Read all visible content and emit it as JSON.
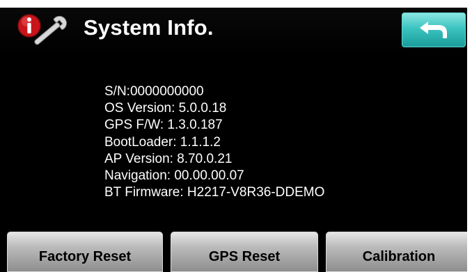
{
  "header": {
    "title": "System Info.",
    "icon": "info-wrench-icon",
    "back_icon": "back-arrow-icon",
    "back_color": "#3cc3c0"
  },
  "info": {
    "lines": [
      "S/N:0000000000",
      "OS Version: 5.0.0.18",
      "GPS F/W: 1.3.0.187",
      "BootLoader: 1.1.1.2",
      "AP Version: 8.70.0.21",
      "Navigation: 00.00.00.07",
      "BT Firmware: H2217-V8R36-DDEMO"
    ]
  },
  "buttons": {
    "factory_reset": "Factory Reset",
    "gps_reset": "GPS Reset",
    "calibration": "Calibration"
  }
}
